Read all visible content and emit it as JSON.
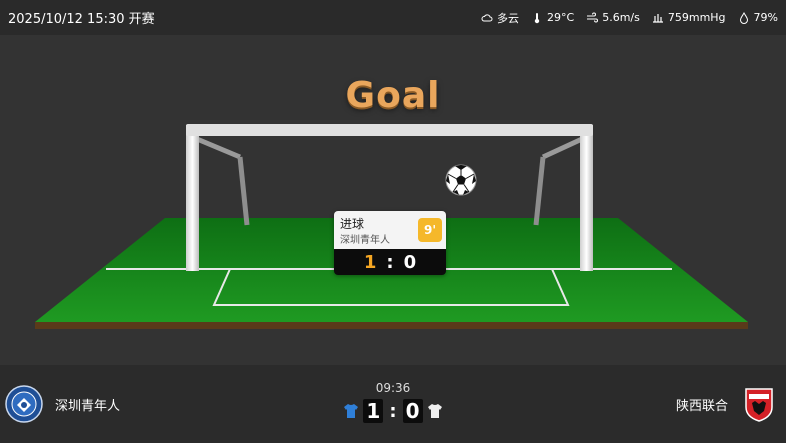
{
  "header": {
    "title": "2025/10/12 15:30 开赛",
    "weather": [
      {
        "icon": "cloud-icon",
        "text": "多云"
      },
      {
        "icon": "thermometer-icon",
        "text": "29°C"
      },
      {
        "icon": "wind-icon",
        "text": "5.6m/s"
      },
      {
        "icon": "pressure-icon",
        "text": "759mmHg"
      },
      {
        "icon": "humidity-icon",
        "text": "79%"
      }
    ]
  },
  "animation": {
    "headline": "Goal",
    "event": {
      "type": "进球",
      "team": "深圳青年人",
      "minute": "9'",
      "home_score": "1",
      "separator": ":",
      "away_score": "0"
    }
  },
  "match": {
    "home_team": "深圳青年人",
    "away_team": "陕西联合",
    "clock": "09:36",
    "home_score": "1",
    "separator": ":",
    "away_score": "0",
    "home_color": "#2f7fd8",
    "away_color": "#eeeeee"
  },
  "colors": {
    "accent": "#f5b82a",
    "grass": "#1d8a1d",
    "background": "#333333"
  }
}
